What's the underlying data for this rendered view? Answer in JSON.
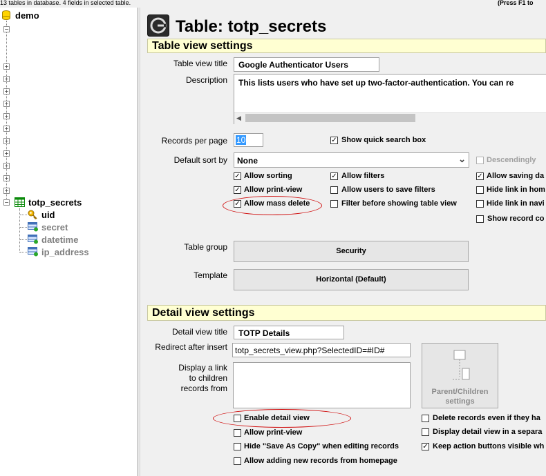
{
  "status_bar": {
    "left_text": "13 tables in database. 4 fields in selected table.",
    "right_text": "(Press F1 to"
  },
  "tree": {
    "database_name": "demo",
    "selected_table": "totp_secrets",
    "fields": [
      "uid",
      "secret",
      "datetime",
      "ip_address"
    ]
  },
  "header": {
    "title": "Table: totp_secrets"
  },
  "table_view": {
    "section_title": "Table view settings",
    "title_label": "Table view title",
    "title_value": "Google Authenticator Users",
    "description_label": "Description",
    "description_value": "This lists users who have set up two-factor-authentication. You can re",
    "records_per_page_label": "Records per page",
    "records_per_page_value": "10",
    "show_quick_search": "Show quick search box",
    "default_sort_label": "Default sort by",
    "default_sort_value": "None",
    "descendingly": "Descendingly",
    "allow_sorting": "Allow sorting",
    "allow_filters": "Allow filters",
    "allow_saving": "Allow saving da",
    "allow_print_view": "Allow print-view",
    "allow_save_filters": "Allow users to save filters",
    "hide_link_home": "Hide link in hom",
    "allow_mass_delete": "Allow mass delete",
    "filter_before": "Filter before showing table view",
    "hide_link_nav": "Hide link in navi",
    "show_record_count": "Show record co",
    "table_group_label": "Table group",
    "table_group_value": "Security",
    "template_label": "Template",
    "template_value": "Horizontal (Default)"
  },
  "detail_view": {
    "section_title": "Detail view settings",
    "title_label": "Detail view title",
    "title_value": "TOTP Details",
    "redirect_label": "Redirect after insert",
    "redirect_value": "totp_secrets_view.php?SelectedID=#ID#",
    "children_label_1": "Display a link",
    "children_label_2": "to children",
    "children_label_3": "records from",
    "parent_children_1": "Parent/Children",
    "parent_children_2": "settings",
    "enable_detail_view": "Enable detail view",
    "allow_print_view": "Allow print-view",
    "hide_save_as_copy": "Hide \"Save As Copy\" when editing records",
    "allow_adding_home": "Allow adding new records from homepage",
    "delete_records_even": "Delete records even if they ha",
    "display_separate": "Display detail view in a separa",
    "keep_action_buttons": "Keep action buttons visible wh"
  },
  "colors": {
    "section_header_bg": "#ffffd2",
    "highlight_oval": "#d01010",
    "field_key_icon": "#e8a800"
  }
}
